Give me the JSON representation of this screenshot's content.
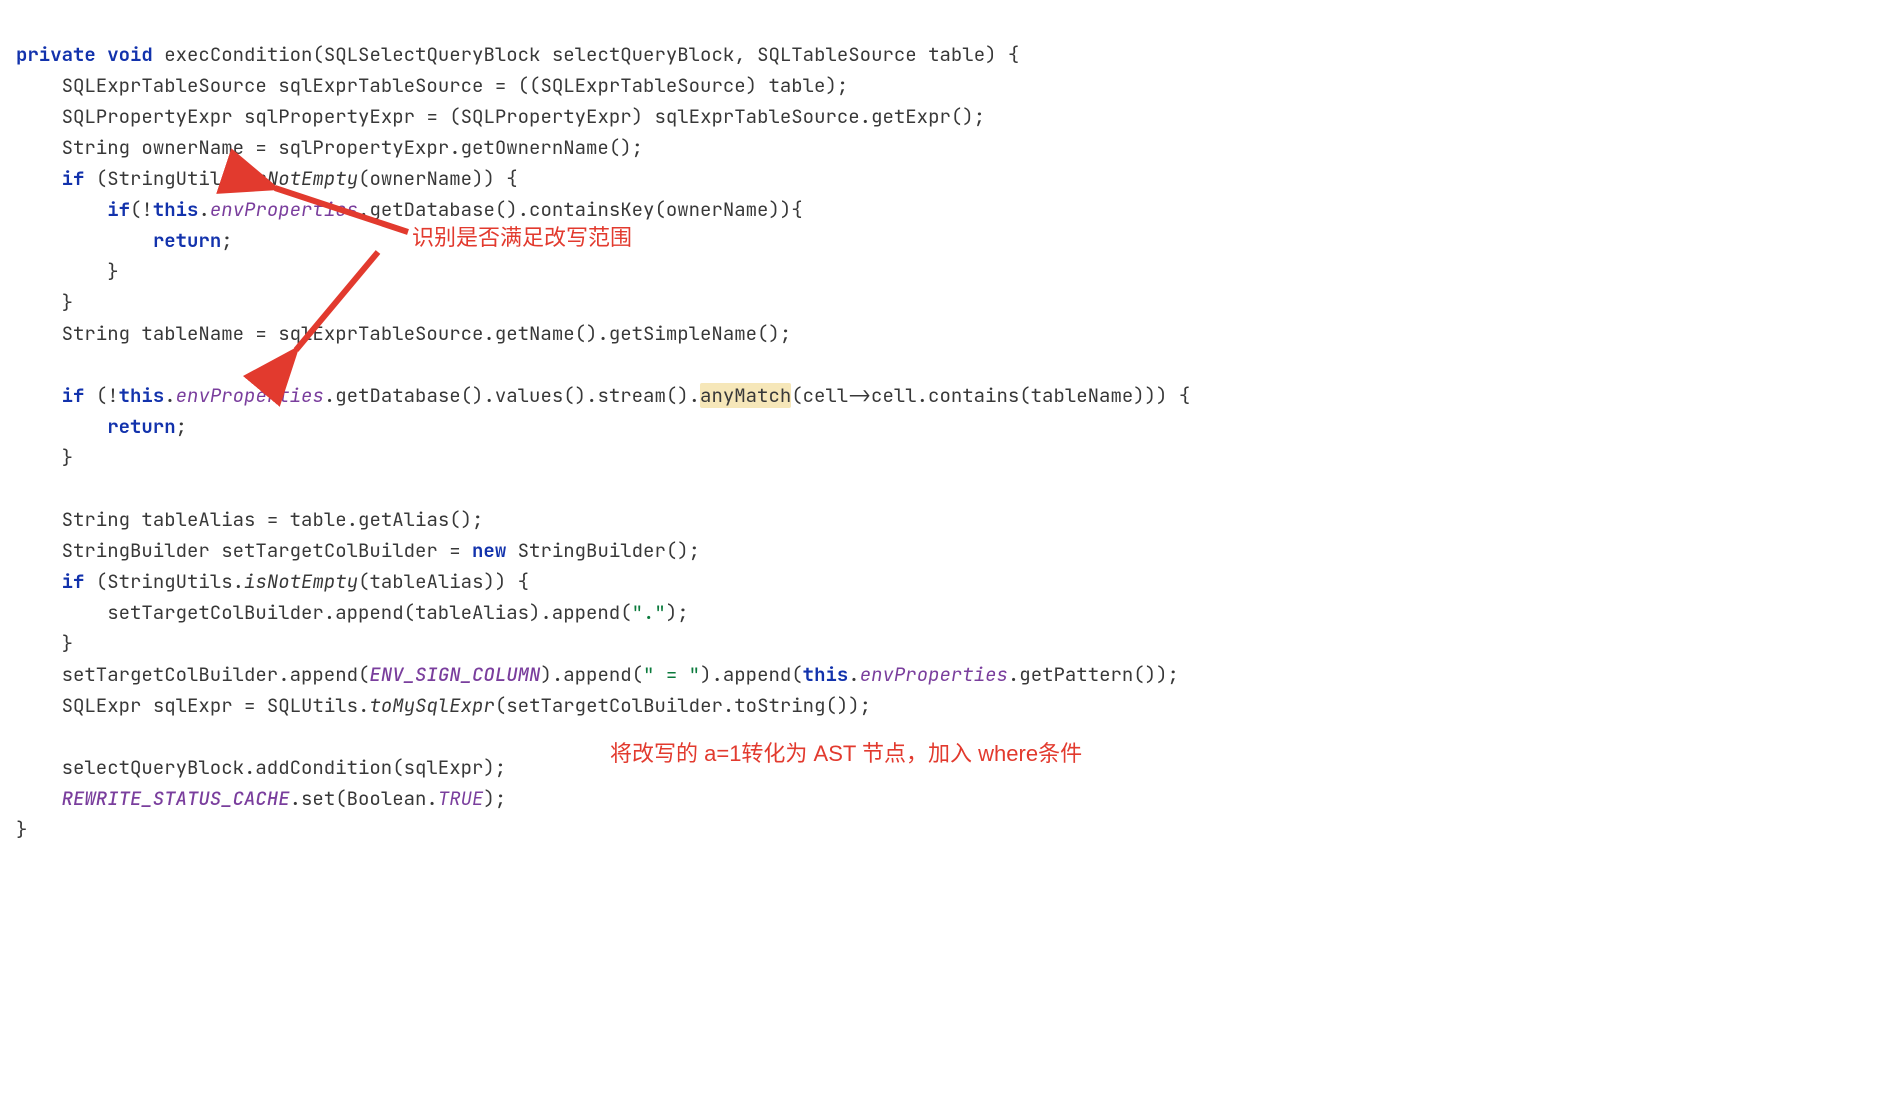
{
  "code": {
    "l1": {
      "kw_private": "private",
      "kw_void": "void",
      "fn": "execCondition",
      "p1_type": "SQLSelectQueryBlock",
      "p1_name": "selectQueryBlock",
      "p2_type": "SQLTableSource",
      "p2_name": "table"
    },
    "l2": {
      "type": "SQLExprTableSource",
      "var": "sqlExprTableSource",
      "cast": "SQLExprTableSource",
      "src": "table"
    },
    "l3": {
      "type": "SQLPropertyExpr",
      "var": "sqlPropertyExpr",
      "cast": "SQLPropertyExpr",
      "call": "sqlExprTableSource.getExpr()"
    },
    "l4": {
      "type": "String",
      "var": "ownerName",
      "call": "sqlPropertyExpr.getOwnernName()"
    },
    "l5": {
      "kw_if": "if",
      "cls": "StringUtils",
      "m": "isNotEmpty",
      "arg": "ownerName"
    },
    "l6": {
      "kw_if": "if",
      "kw_this": "this",
      "field": "envProperties",
      "call": ".getDatabase().containsKey(ownerName)){"
    },
    "l7": {
      "kw_return": "return"
    },
    "l8": {
      "brace": "}"
    },
    "l9": {
      "brace": "}"
    },
    "l10": {
      "type": "String",
      "var": "tableName",
      "call": "sqlExprTableSource.getName().getSimpleName()"
    },
    "l12": {
      "kw_if": "if",
      "kw_this": "this",
      "field": "envProperties",
      "pre": ".getDatabase().values().stream().",
      "hl": "anyMatch",
      "post": "(cell->cell.contains(tableName))) {"
    },
    "l13": {
      "kw_return": "return"
    },
    "l14": {
      "brace": "}"
    },
    "l16": {
      "type": "String",
      "var": "tableAlias",
      "call": "table.getAlias()"
    },
    "l17": {
      "type": "StringBuilder",
      "var": "setTargetColBuilder",
      "kw_new": "new",
      "ctor": "StringBuilder()"
    },
    "l18": {
      "kw_if": "if",
      "cls": "StringUtils",
      "m": "isNotEmpty",
      "arg": "tableAlias"
    },
    "l19": {
      "obj": "setTargetColBuilder.append(tableAlias).append(",
      "str": "\".\"",
      "close": ");"
    },
    "l20": {
      "brace": "}"
    },
    "l21": {
      "pre": "setTargetColBuilder.append(",
      "const": "ENV_SIGN_COLUMN",
      "mid1": ").append(",
      "str": "\" = \"",
      "mid2": ").append(",
      "kw_this": "this",
      "field": "envProperties",
      "post": ".getPattern());"
    },
    "l22": {
      "type": "SQLExpr",
      "var": "sqlExpr",
      "cls": "SQLUtils",
      "m": "toMySqlExpr",
      "arg": "setTargetColBuilder.toString()"
    },
    "l24": {
      "call": "selectQueryBlock.addCondition(sqlExpr);"
    },
    "l25": {
      "const": "REWRITE_STATUS_CACHE",
      "pre": ".set(Boolean.",
      "boolc": "TRUE",
      "post": ");"
    },
    "l26": {
      "brace": "}"
    }
  },
  "annotations": {
    "a1": "识别是否满足改写范围",
    "a2": "将改写的 a=1转化为 AST 节点，加入 where条件"
  }
}
